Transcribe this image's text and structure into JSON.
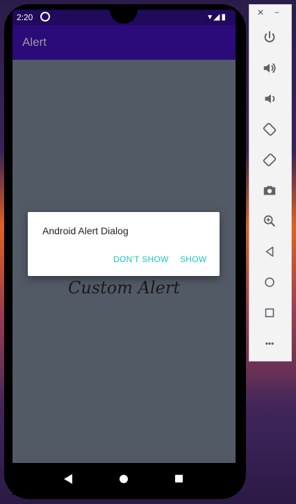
{
  "status_bar": {
    "time": "2:20",
    "right_icons": "▾◢▮"
  },
  "app_bar": {
    "title": "Alert"
  },
  "dialog": {
    "message": "Android Alert Dialog",
    "dont_show_label": "DON'T SHOW",
    "show_label": "SHOW"
  },
  "background_text": "Custom Alert",
  "emulator_panel": {
    "close_label": "✕",
    "minimize_label": "−",
    "tools": [
      "power-icon",
      "volume-up-icon",
      "volume-down-icon",
      "rotate-left-icon",
      "rotate-right-icon",
      "camera-icon",
      "zoom-icon",
      "back-icon",
      "home-icon",
      "overview-icon",
      "more-icon"
    ],
    "more_label": "•••"
  },
  "colors": {
    "app_bar": "#2b0a7a",
    "status_bar": "#1f0a5c",
    "accent": "#18c7bc",
    "screen_bg": "#525a66"
  }
}
